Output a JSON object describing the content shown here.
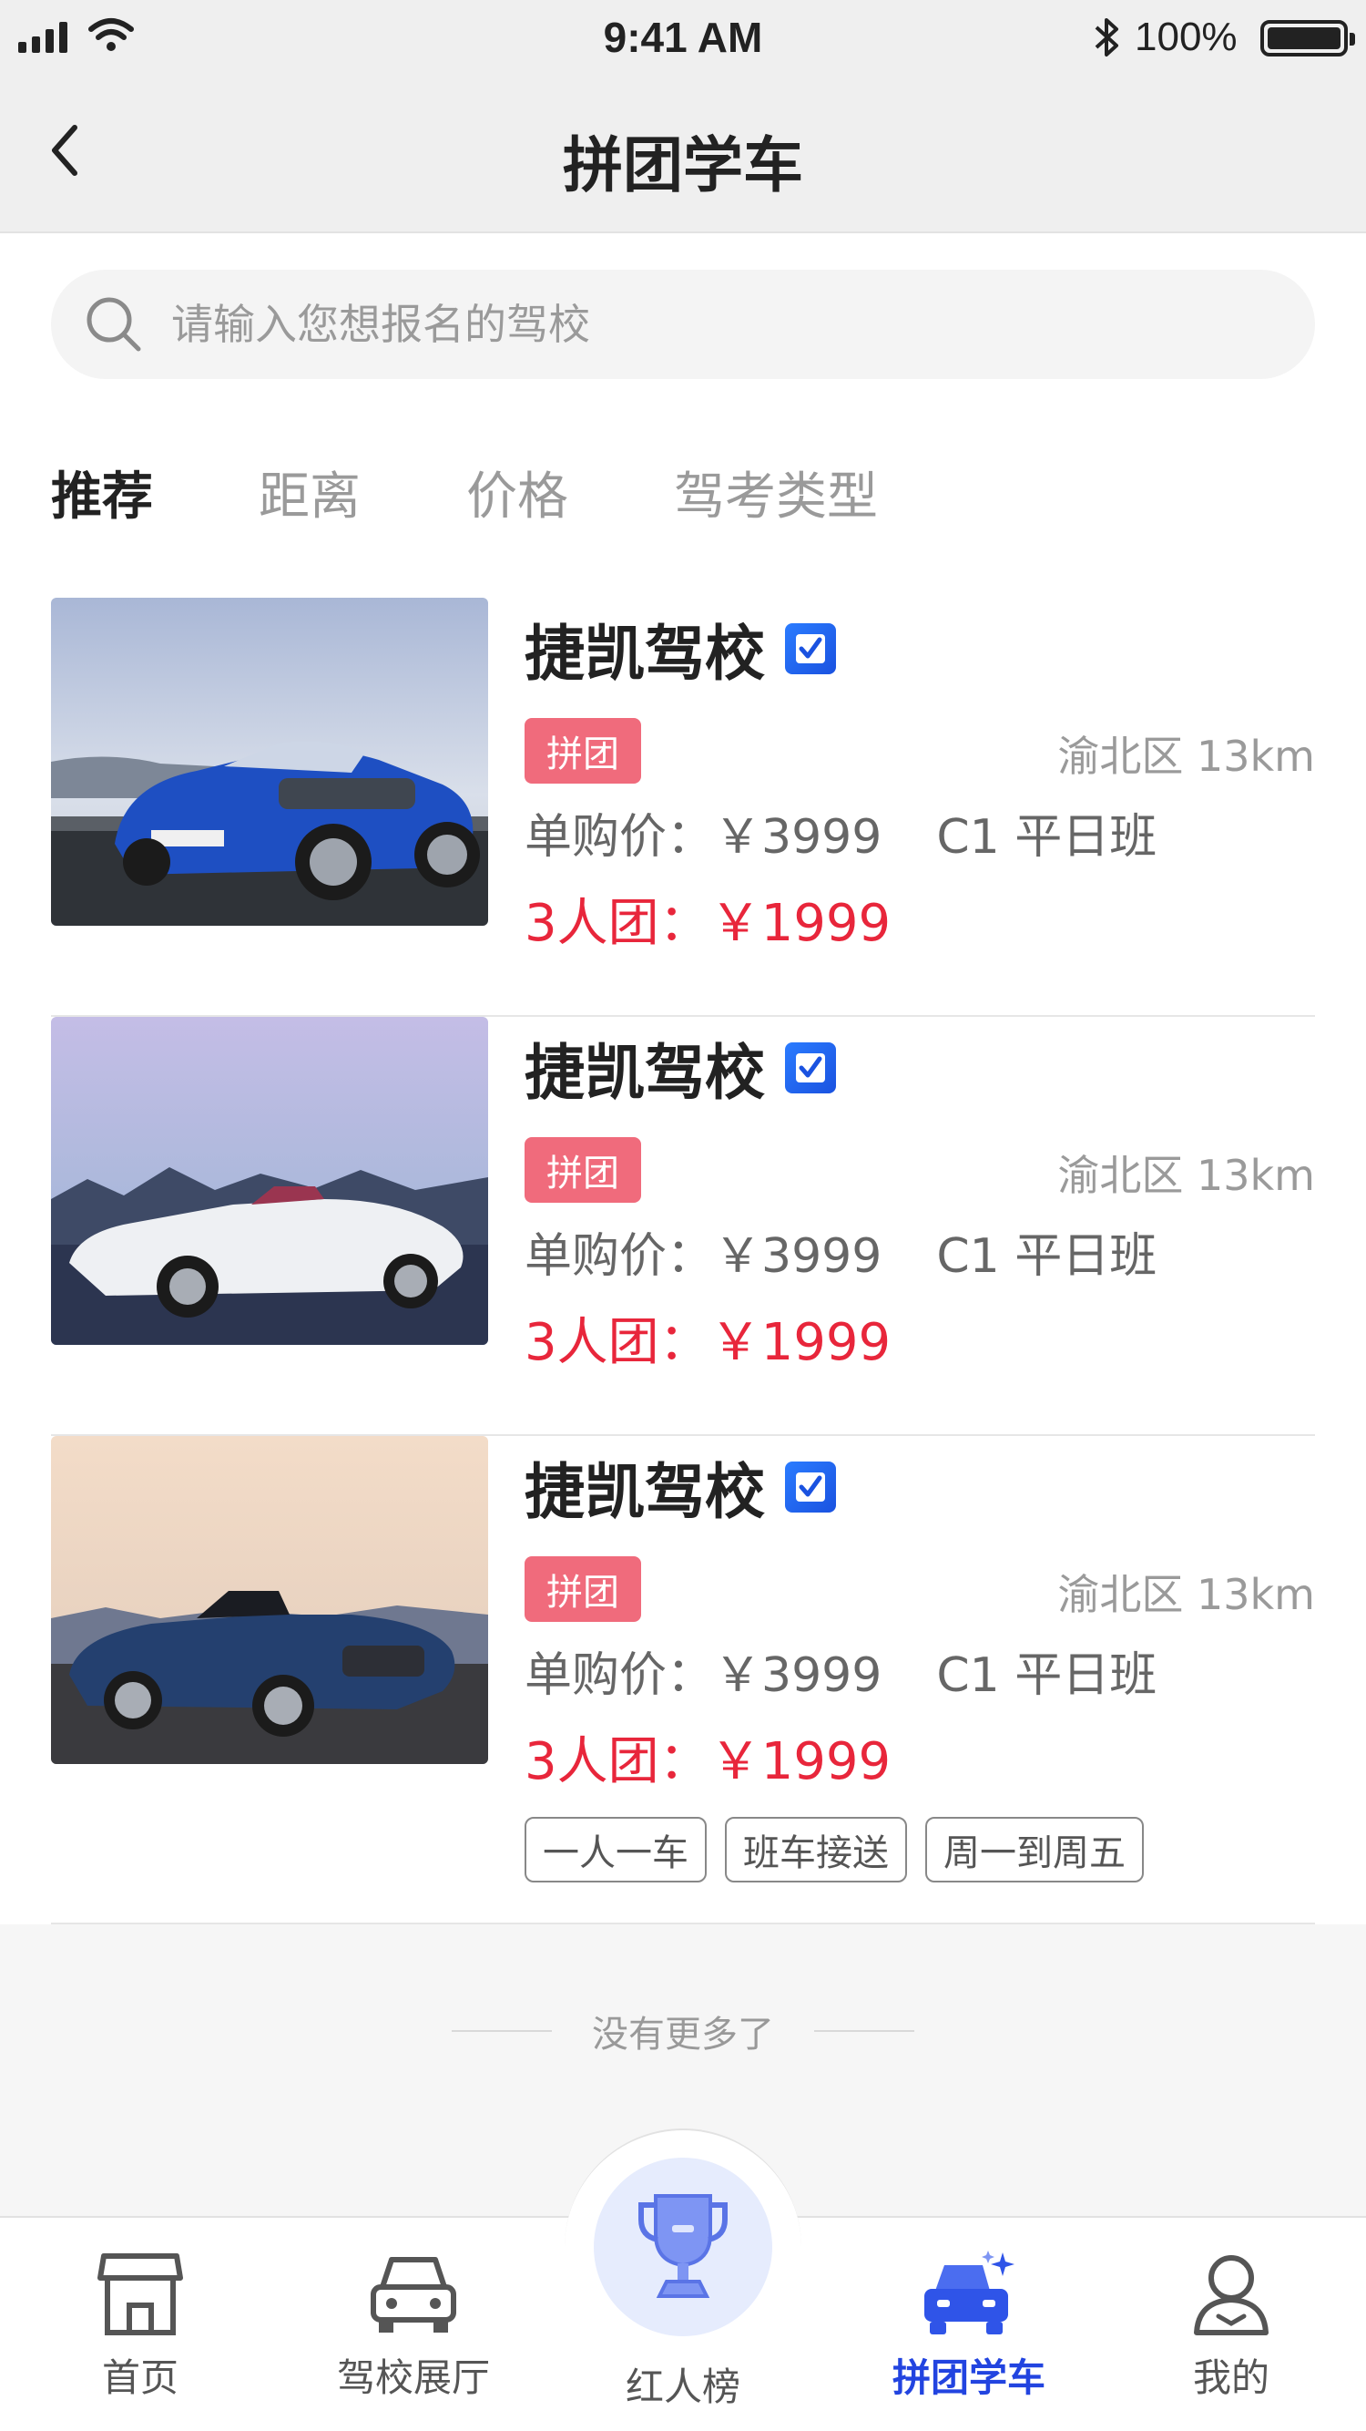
{
  "status_bar": {
    "time": "9:41 AM",
    "battery": "100%"
  },
  "header": {
    "title": "拼团学车"
  },
  "search": {
    "placeholder": "请输入您想报名的驾校"
  },
  "filters": [
    "推荐",
    "距离",
    "价格",
    "驾考类型"
  ],
  "schools": [
    {
      "name": "捷凯驾校",
      "badge": "拼团",
      "distance": "渝北区 13km",
      "single_price": "单购价：￥3999",
      "class": "C1 平日班",
      "group_price": "3人团：￥1999",
      "car": "blue-sports-car"
    },
    {
      "name": "捷凯驾校",
      "badge": "拼团",
      "distance": "渝北区 13km",
      "single_price": "单购价：￥3999",
      "class": "C1 平日班",
      "group_price": "3人团：￥1999",
      "car": "white-convertible"
    },
    {
      "name": "捷凯驾校",
      "badge": "拼团",
      "distance": "渝北区 13km",
      "single_price": "单购价：￥3999",
      "class": "C1 平日班",
      "group_price": "3人团：￥1999",
      "car": "navy-convertible",
      "tags": [
        "一人一车",
        "班车接送",
        "周一到周五"
      ]
    }
  ],
  "footer_note": "没有更多了",
  "tabbar": [
    {
      "label": "首页",
      "icon": "home-icon"
    },
    {
      "label": "驾校展厅",
      "icon": "car-icon"
    },
    {
      "label": "红人榜",
      "icon": "trophy-icon"
    },
    {
      "label": "拼团学车",
      "icon": "group-car-icon",
      "active": true
    },
    {
      "label": "我的",
      "icon": "user-icon"
    }
  ],
  "colors": {
    "accent": "#2244e0",
    "price": "#e8263b",
    "badge": "#f06b7c"
  }
}
